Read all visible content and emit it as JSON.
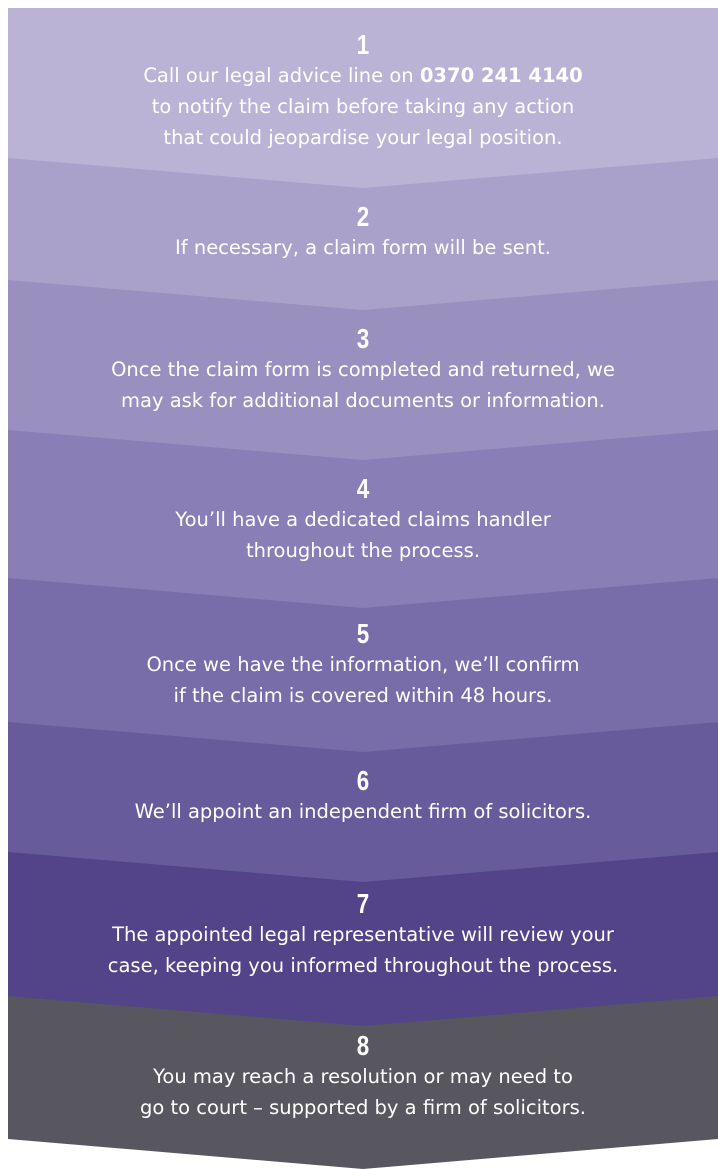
{
  "steps": [
    {
      "number": "1",
      "text_before": "Call our legal advice line on ",
      "phone": "0370 241 4140",
      "text_after": "\nto notify the claim before taking any action\nthat could jeopardise your legal position.",
      "color": "#bab3d6"
    },
    {
      "number": "2",
      "text": "If necessary, a claim form will be sent.",
      "color": "#aaa1cb"
    },
    {
      "number": "3",
      "text": "Once the claim form is completed and returned, we\nmay ask for additional documents or information.",
      "color": "#9a90c0"
    },
    {
      "number": "4",
      "text": "You’ll have a dedicated claims handler\nthroughout the process.",
      "color": "#897eb5"
    },
    {
      "number": "5",
      "text": "Once we have the information, we’ll confirm\nif the claim is covered within 48 hours.",
      "color": "#786da9"
    },
    {
      "number": "6",
      "text": "We’ll appoint an independent firm of solicitors.",
      "color": "#685b9b"
    },
    {
      "number": "7",
      "text": "The appointed legal representative will review your\ncase, keeping you informed throughout the process.",
      "color": "#534489"
    },
    {
      "number": "8",
      "text": "You may reach a resolution or may need to\ngo to court – supported by a firm of solicitors.",
      "color": "#58565e"
    }
  ]
}
